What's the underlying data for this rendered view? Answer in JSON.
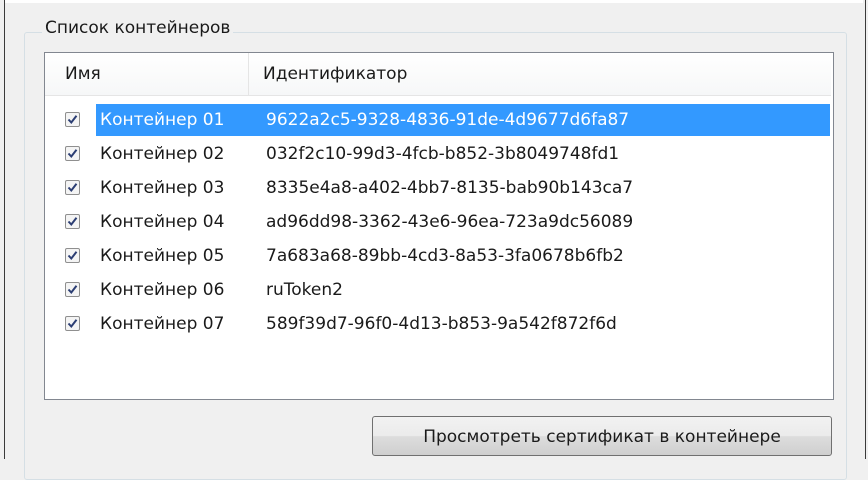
{
  "group": {
    "title": "Список контейнеров"
  },
  "list": {
    "columns": {
      "name": "Имя",
      "id": "Идентификатор"
    },
    "rows": [
      {
        "checked": true,
        "name": "Контейнер 01",
        "id": "9622a2c5-9328-4836-91de-4d9677d6fa87",
        "selected": true
      },
      {
        "checked": true,
        "name": "Контейнер 02",
        "id": "032f2c10-99d3-4fcb-b852-3b8049748fd1"
      },
      {
        "checked": true,
        "name": "Контейнер 03",
        "id": "8335e4a8-a402-4bb7-8135-bab90b143ca7"
      },
      {
        "checked": true,
        "name": "Контейнер 04",
        "id": "ad96dd98-3362-43e6-96ea-723a9dc56089"
      },
      {
        "checked": true,
        "name": "Контейнер 05",
        "id": "7a683a68-89bb-4cd3-8a53-3fa0678b6fb2"
      },
      {
        "checked": true,
        "name": "Контейнер 06",
        "id": "ruToken2"
      },
      {
        "checked": true,
        "name": "Контейнер 07",
        "id": "589f39d7-96f0-4d13-b853-9a542f872f6d"
      }
    ]
  },
  "buttons": {
    "view_certificate": "Просмотреть сертификат в контейнере"
  },
  "colors": {
    "selection": "#3399ff",
    "border": "#828790"
  },
  "icons": {
    "checkbox": "checkmark-icon"
  }
}
